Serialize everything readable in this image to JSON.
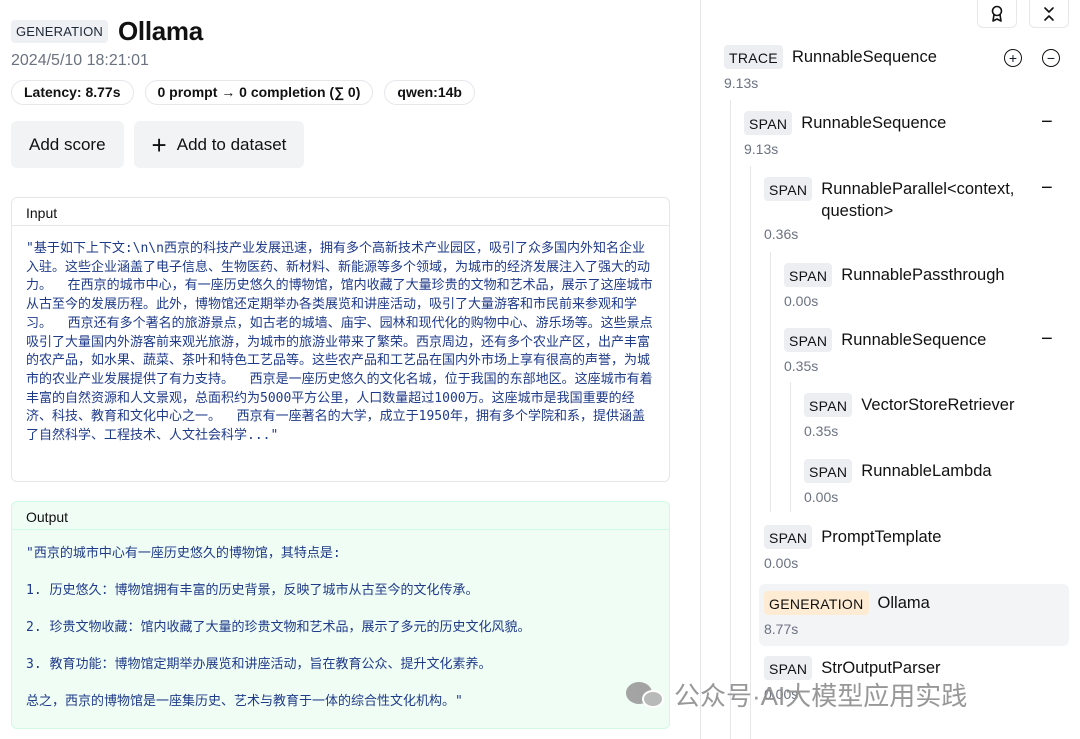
{
  "header": {
    "type_tag": "GENERATION",
    "title": "Ollama",
    "timestamp": "2024/5/10 18:21:01",
    "badges": [
      "Latency: 8.77s",
      "0 prompt → 0 completion (∑ 0)",
      "qwen:14b"
    ]
  },
  "actions": {
    "add_score": "Add score",
    "add_to_dataset": "Add to dataset",
    "plus_icon": "+"
  },
  "input": {
    "label": "Input",
    "text": "\"基于如下上下文:\\n\\n西京的科技产业发展迅速，拥有多个高新技术产业园区，吸引了众多国内外知名企业入驻。这些企业涵盖了电子信息、生物医药、新材料、新能源等多个领域，为城市的经济发展注入了强大的动力。  在西京的城市中心，有一座历史悠久的博物馆，馆内收藏了大量珍贵的文物和艺术品，展示了这座城市从古至今的发展历程。此外，博物馆还定期举办各类展览和讲座活动，吸引了大量游客和市民前来参观和学习。  西京还有多个著名的旅游景点，如古老的城墙、庙宇、园林和现代化的购物中心、游乐场等。这些景点吸引了大量国内外游客前来观光旅游，为城市的旅游业带来了繁荣。西京周边，还有多个农业产区，出产丰富的农产品，如水果、蔬菜、茶叶和特色工艺品等。这些农产品和工艺品在国内外市场上享有很高的声誉，为城市的农业产业发展提供了有力支持。  西京是一座历史悠久的文化名城，位于我国的东部地区。这座城市有着丰富的自然资源和人文景观，总面积约为5000平方公里，人口数量超过1000万。这座城市是我国重要的经济、科技、教育和文化中心之一。  西京有一座著名的大学，成立于1950年，拥有多个学院和系，提供涵盖了自然科学、工程技术、人文社会科学...\""
  },
  "output": {
    "label": "Output",
    "lines": [
      "\"西京的城市中心有一座历史悠久的博物馆，其特点是:",
      "1. 历史悠久：博物馆拥有丰富的历史背景，反映了城市从古至今的文化传承。",
      "2. 珍贵文物收藏：馆内收藏了大量的珍贵文物和艺术品，展示了多元的历史文化风貌。",
      "3. 教育功能：博物馆定期举办展览和讲座活动，旨在教育公众、提升文化素养。",
      "总之，西京的博物馆是一座集历史、艺术与教育于一体的综合性文化机构。\""
    ]
  },
  "trace": {
    "toolbar_icons": [
      "ribbon-icon",
      "collapse-icon"
    ],
    "expand_all": "+",
    "collapse_all": "−",
    "nodes": [
      {
        "tag": "TRACE",
        "name": "RunnableSequence",
        "duration": "9.13s"
      },
      {
        "tag": "SPAN",
        "name": "RunnableSequence",
        "duration": "9.13s",
        "toggle": "−"
      },
      {
        "tag": "SPAN",
        "name": "RunnableParallel<context, question>",
        "duration": "0.36s",
        "toggle": "−"
      },
      {
        "tag": "SPAN",
        "name": "RunnablePassthrough",
        "duration": "0.00s"
      },
      {
        "tag": "SPAN",
        "name": "RunnableSequence",
        "duration": "0.35s",
        "toggle": "−"
      },
      {
        "tag": "SPAN",
        "name": "VectorStoreRetriever",
        "duration": "0.35s"
      },
      {
        "tag": "SPAN",
        "name": "RunnableLambda",
        "duration": "0.00s"
      },
      {
        "tag": "SPAN",
        "name": "PromptTemplate",
        "duration": "0.00s"
      },
      {
        "tag": "GENERATION",
        "name": "Ollama",
        "duration": "8.77s"
      },
      {
        "tag": "SPAN",
        "name": "StrOutputParser",
        "duration": "0.00s"
      }
    ]
  },
  "watermark": {
    "icon": "wechat-icon",
    "text": "公众号·AI大模型应用实践"
  }
}
